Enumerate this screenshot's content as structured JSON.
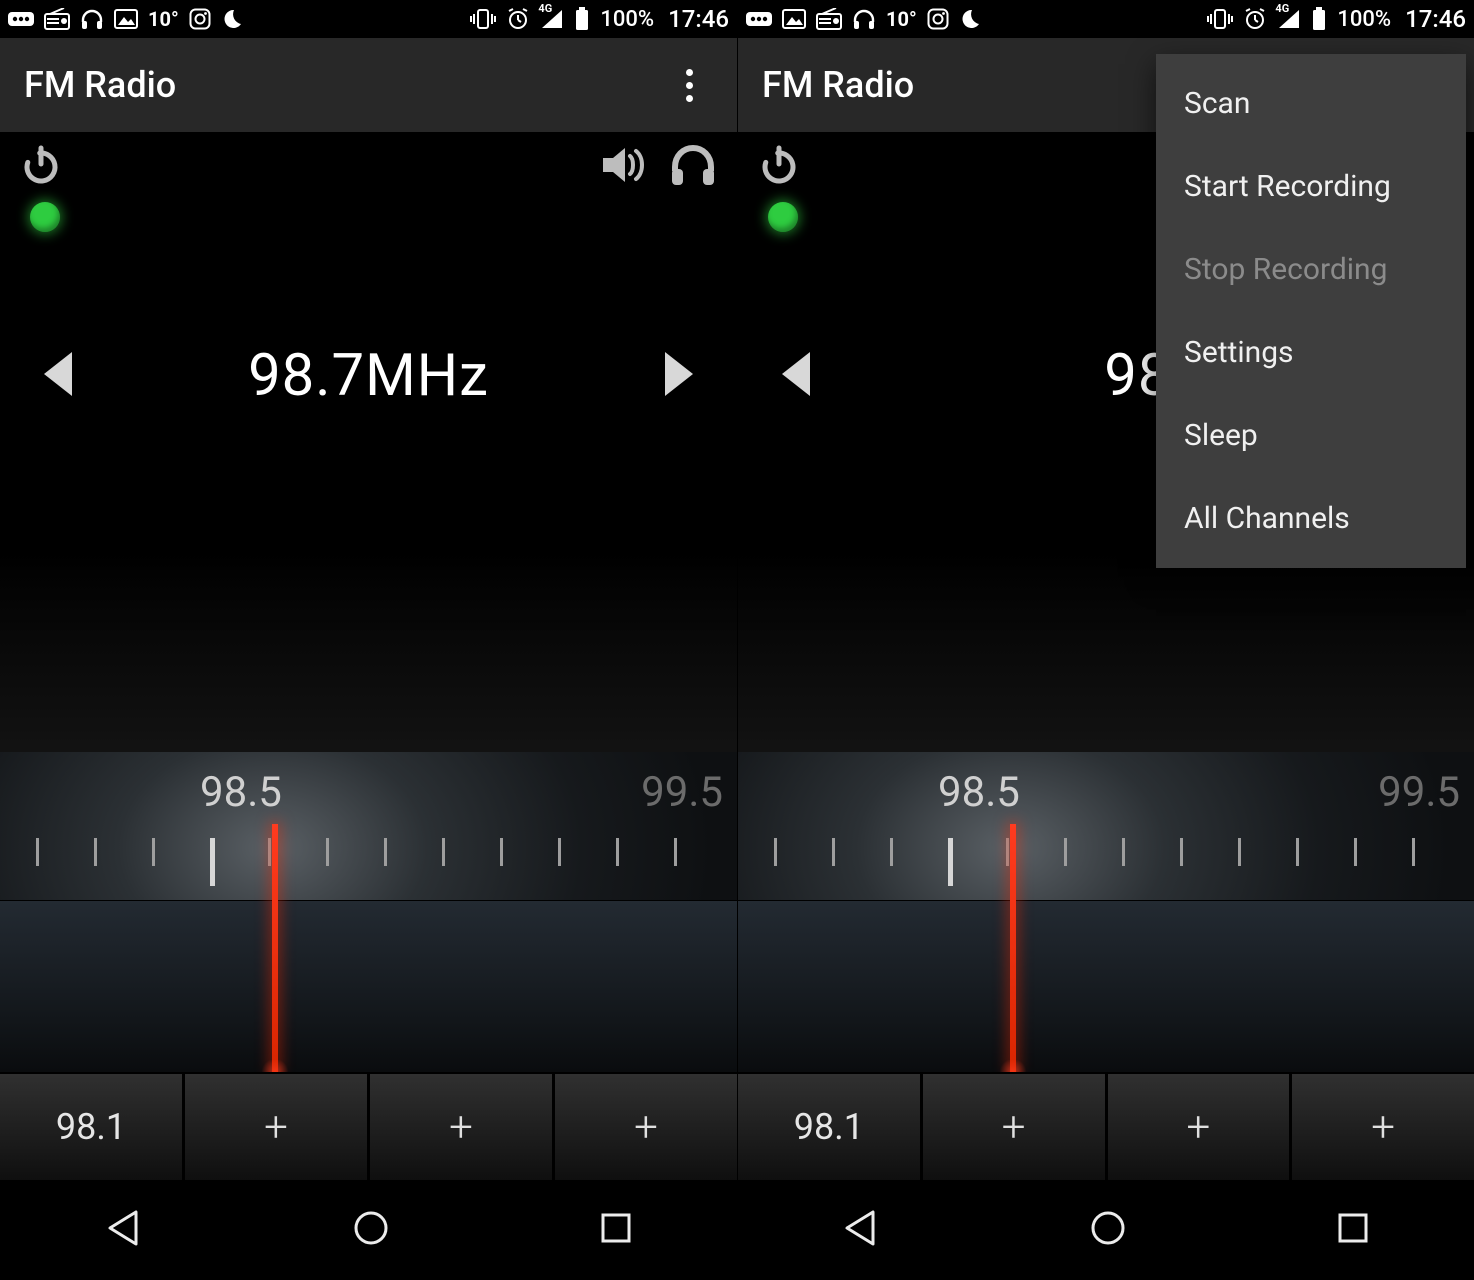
{
  "status": {
    "temp": "10°",
    "network_label": "4G",
    "battery_pct": "100%",
    "time": "17:46"
  },
  "app": {
    "title": "FM Radio"
  },
  "radio": {
    "frequency_display": "98.7MHz",
    "frequency_display_truncated": "98.",
    "dial": {
      "label_center": "98.5",
      "label_right": "99.5"
    },
    "presets": [
      "98.1",
      "+",
      "+",
      "+"
    ]
  },
  "menu": {
    "items": [
      {
        "label": "Scan",
        "enabled": true
      },
      {
        "label": "Start Recording",
        "enabled": true
      },
      {
        "label": "Stop Recording",
        "enabled": false
      },
      {
        "label": "Settings",
        "enabled": true
      },
      {
        "label": "Sleep",
        "enabled": true
      },
      {
        "label": "All Channels",
        "enabled": true
      }
    ]
  }
}
